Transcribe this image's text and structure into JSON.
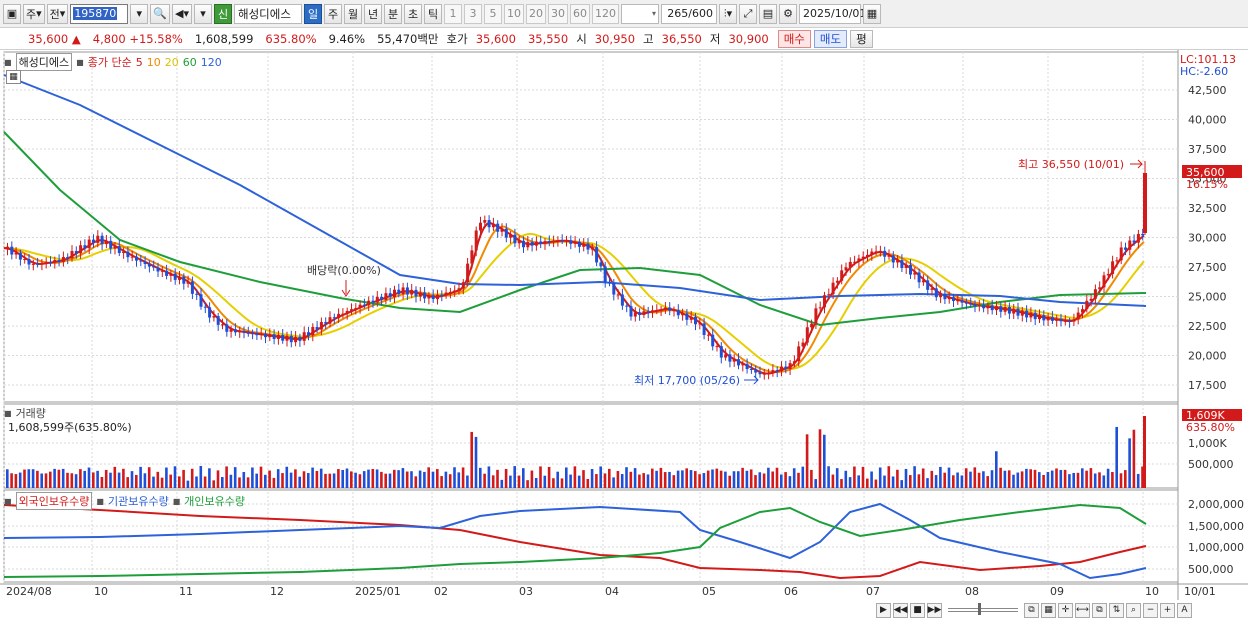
{
  "toolbar": {
    "mode_label": "주",
    "prev_label": "전",
    "code": "195870",
    "new_badge": "신",
    "stock_name": "해성디에스",
    "periods": [
      "일",
      "주",
      "월",
      "년",
      "분",
      "초",
      "틱"
    ],
    "active_period": "일",
    "minute_presets": [
      "1",
      "3",
      "5",
      "10",
      "20",
      "30",
      "60",
      "120"
    ],
    "page_count": "265",
    "page_total": "/600",
    "date": "2025/10/01"
  },
  "quote": {
    "price": "35,600",
    "change_arrow": "▲",
    "change": "4,800",
    "change_pct": "+15.58%",
    "volume": "1,608,599",
    "volume_ratio": "635.80%",
    "turnover": "9.46%",
    "amount": "55,470백만",
    "quote_label": "호가",
    "ask": "35,600",
    "bid": "35,550",
    "open_label": "시",
    "open": "30,950",
    "high_label": "고",
    "high": "36,550",
    "low_label": "저",
    "low": "30,900",
    "buy_label": "매수",
    "sell_label": "매도",
    "eval_label": "평"
  },
  "price_panel": {
    "name": "해성디에스",
    "ma_label": "종가 단순",
    "ma_periods": [
      "5",
      "10",
      "20",
      "60",
      "120"
    ],
    "ma_colors": [
      "#d21a1a",
      "#f08a00",
      "#e6cf00",
      "#1e9e3a",
      "#2e62d9"
    ],
    "lc": "LC:101.13",
    "hc": "HC:-2.60",
    "y_ticks": [
      "42,500",
      "40,000",
      "37,500",
      "35,000",
      "32,500",
      "30,000",
      "27,500",
      "25,000",
      "22,500",
      "20,000",
      "17,500"
    ],
    "last_price_tag": "35,600",
    "last_pct_tag": "16.15%",
    "high_annotation": "최고 36,550 (10/01)",
    "low_annotation": "최저 17,700 (05/26)",
    "dividend_annotation": "배당락(0.00%)"
  },
  "volume_panel": {
    "title": "거래량",
    "value_line": "1,608,599주(635.80%)",
    "tag_value": "1,609K",
    "tag_pct": "635.80%",
    "y_ticks": [
      "1,000K",
      "500,000"
    ]
  },
  "holdings_panel": {
    "legend": [
      "외국인보유수량",
      "기관보유수량",
      "개인보유수량"
    ],
    "legend_colors": [
      "#d21a1a",
      "#2e62d9",
      "#1e9e3a"
    ],
    "y_ticks": [
      "2,000,000",
      "1,500,000",
      "1,000,000",
      "500,000"
    ]
  },
  "x_axis": {
    "labels": [
      "2024/08",
      "10",
      "11",
      "12",
      "2025/01",
      "02",
      "03",
      "04",
      "05",
      "06",
      "07",
      "08",
      "09",
      "10",
      "10/01"
    ]
  }
}
